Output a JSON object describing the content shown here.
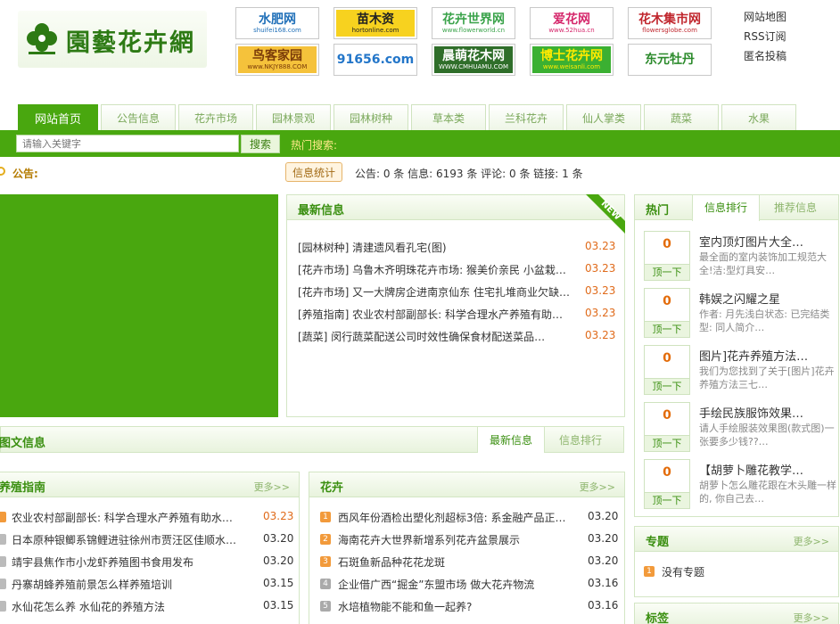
{
  "site": {
    "logo_text": "園藝花卉網"
  },
  "partners": [
    {
      "label": "水肥网",
      "sub": "shuifei168.com",
      "bg": "#ffffff",
      "fg": "#1f6fb8"
    },
    {
      "label": "苗木资",
      "sub": "hortonline.com",
      "bg": "#f7d21f",
      "fg": "#222222"
    },
    {
      "label": "花卉世界网",
      "sub": "www.flowerworld.cn",
      "bg": "#ffffff",
      "fg": "#3aa34a"
    },
    {
      "label": "爱花网",
      "sub": "www.52hua.cn",
      "bg": "#ffffff",
      "fg": "#d5276b"
    },
    {
      "label": "花木集市网",
      "sub": "flowersglobe.com",
      "bg": "#ffffff",
      "fg": "#c0262d"
    },
    {
      "label": "鸟客家园",
      "sub": "www.NKJY888.COM",
      "bg": "#f5c23b",
      "fg": "#7a3a08"
    },
    {
      "label": "91656.com",
      "sub": "",
      "bg": "#ffffff",
      "fg": "#2376c9"
    },
    {
      "label": "晨萌花木网",
      "sub": "WWW.CMHUAMU.COM",
      "bg": "#2f6e2a",
      "fg": "#ffffff"
    },
    {
      "label": "博士花卉网",
      "sub": "www.weisanli.com",
      "bg": "#3bb032",
      "fg": "#ffea00"
    },
    {
      "label": "东元牡丹",
      "sub": "",
      "bg": "#ffffff",
      "fg": "#2b8a2b"
    }
  ],
  "toplinks": [
    "网站地图",
    "RSS订阅",
    "匿名投稿"
  ],
  "nav": {
    "tabs": [
      "网站首页",
      "公告信息",
      "花卉市场",
      "园林景观",
      "园林树种",
      "草本类",
      "兰科花卉",
      "仙人掌类",
      "蔬菜",
      "水果"
    ]
  },
  "search": {
    "placeholder": "请输入关键字",
    "button": "搜索",
    "hot_label": "热门搜索:"
  },
  "notice": {
    "label": "公告:",
    "stats_button": "信息统计",
    "stats_text": "公告: 0 条 信息: 6193 条 评论: 0 条 链接: 1 条"
  },
  "latest": {
    "title": "最新信息",
    "ribbon": "NEW",
    "items": [
      {
        "text": "[园林树种] 清建遗风看孔宅(图)",
        "date": "03.23"
      },
      {
        "text": "[花卉市场] 乌鲁木齐明珠花卉市场: 猴美价亲民  小盆栽…",
        "date": "03.23"
      },
      {
        "text": "[花卉市场] 又一大牌房企进南京仙东  住宅扎堆商业欠缺…",
        "date": "03.23"
      },
      {
        "text": "[养殖指南] 农业农村部副部长: 科学合理水产养殖有助…",
        "date": "03.23"
      },
      {
        "text": "[蔬菜] 闵行蔬菜配送公司时效性确保食材配送菜品…",
        "date": "03.23"
      }
    ]
  },
  "picnews": {
    "title": "图文信息",
    "tabs": [
      "最新信息",
      "信息排行"
    ]
  },
  "guide": {
    "title": "养殖指南",
    "more": "更多>>",
    "items": [
      {
        "text": "农业农村部副部长: 科学合理水产养殖有助水…",
        "date": "03.23"
      },
      {
        "text": "日本原种银鲫系锦鲤进驻徐州市贾汪区佳顺水…",
        "date": "03.20"
      },
      {
        "text": "靖宇县焦作市小龙虾养殖图书食用发布",
        "date": "03.20"
      },
      {
        "text": "丹寨胡蜂养殖前景怎么样养殖培训",
        "date": "03.15"
      },
      {
        "text": "水仙花怎么养 水仙花的养殖方法",
        "date": "03.15"
      }
    ]
  },
  "flowers": {
    "title": "花卉",
    "more": "更多>>",
    "items": [
      {
        "text": "西风年份酒检出塑化剂超标3倍: 系金融产品正…",
        "date": "03.20"
      },
      {
        "text": "海南花卉大世界新增系列花卉盆景展示",
        "date": "03.20"
      },
      {
        "text": "石斑鱼新品种花花龙斑",
        "date": "03.20"
      },
      {
        "text": "企业借广西“掘金”东盟市场 做大花卉物流",
        "date": "03.16"
      },
      {
        "text": "水培植物能不能和鱼一起养?",
        "date": "03.16"
      }
    ]
  },
  "hot": {
    "title": "热门",
    "tabs": [
      "信息排行",
      "推荐信息"
    ],
    "vote_label": "顶一下",
    "items": [
      {
        "count": "0",
        "title": "室内顶灯图片大全…",
        "desc": "最全面的室内装饰加工规范大全!洁:型灯具安…"
      },
      {
        "count": "0",
        "title": "韩娱之闪耀之星",
        "desc": "作者: 月先浅白状态: 已完结类型: 同人简介…"
      },
      {
        "count": "0",
        "title": "图片]花卉养殖方法…",
        "desc": "我们为您找到了关于[图片]花卉养殖方法三七…"
      },
      {
        "count": "0",
        "title": "手绘民族服饰效果…",
        "desc": "请人手绘服装效果图(款式图)一张要多少钱??…"
      },
      {
        "count": "0",
        "title": "【胡萝卜雕花教学…",
        "desc": "胡萝卜怎么雕花跟在木头雕一样的, 你自己去…"
      }
    ]
  },
  "topic": {
    "title": "专题",
    "more": "更多>>",
    "item": "没有专题"
  },
  "tags": {
    "title": "标签",
    "more": "更多>>"
  },
  "colors": {
    "brand_green": "#49a70f",
    "date_orange": "#e06b1b"
  }
}
